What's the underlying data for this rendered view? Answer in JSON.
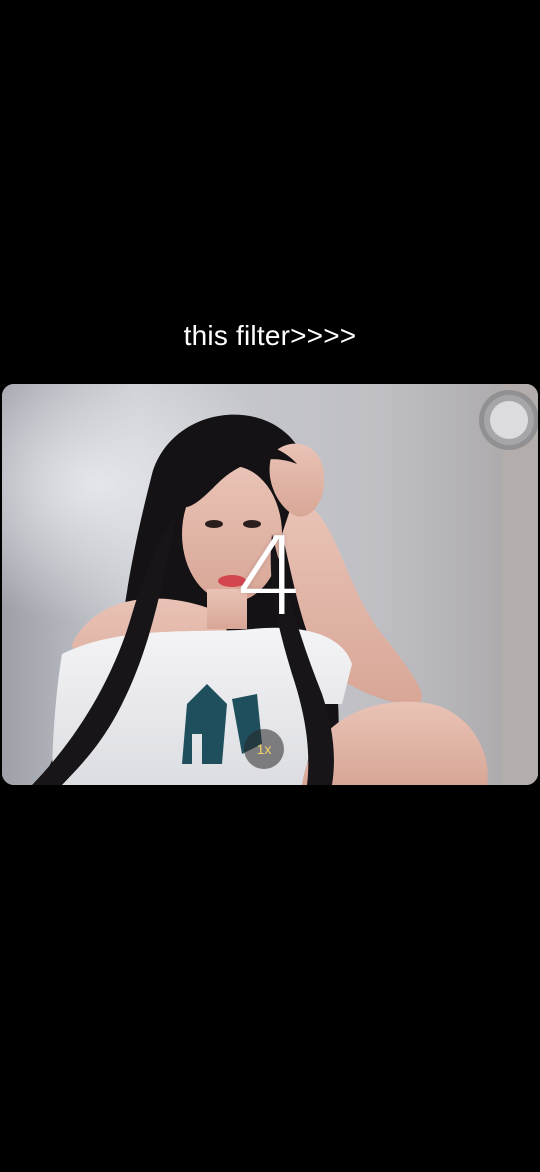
{
  "caption": "this filter>>>>",
  "camera": {
    "countdown": "4",
    "zoom_label": "1x",
    "photo_subject": "selfie-photo",
    "shutter_icon": "shutter-icon"
  },
  "colors": {
    "background": "#000000",
    "caption_text": "#ffffff",
    "zoom_text": "#f3d36b"
  }
}
